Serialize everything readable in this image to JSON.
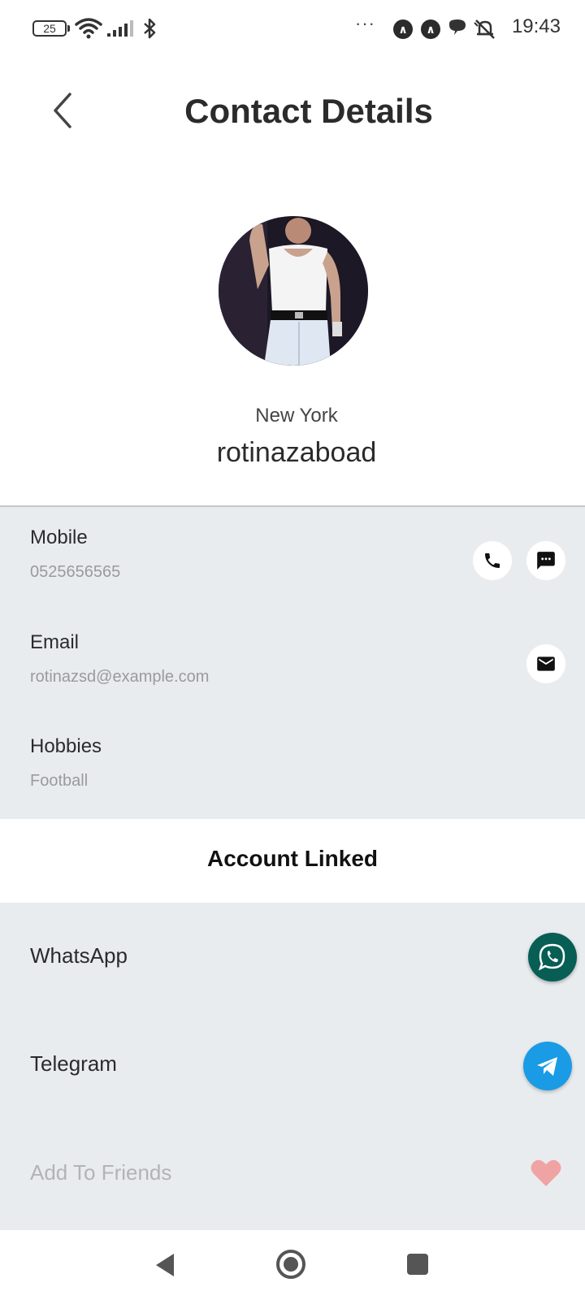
{
  "status_bar": {
    "battery_level": "25",
    "time": "19:43",
    "more": "···",
    "icons": [
      "battery-icon",
      "wifi-icon",
      "signal-icon",
      "bluetooth-icon",
      "more-icon",
      "app-notification-icon",
      "app-notification-icon",
      "chat-bubble-icon",
      "alarm-off-icon"
    ]
  },
  "header": {
    "title": "Contact Details",
    "back_icon": "chevron-left-icon"
  },
  "profile": {
    "city": "New York",
    "username": "rotinazaboad"
  },
  "fields": {
    "mobile": {
      "label": "Mobile",
      "value": "0525656565",
      "actions": [
        "phone-icon",
        "message-icon"
      ]
    },
    "email": {
      "label": "Email",
      "value": "rotinazsd@example.com",
      "actions": [
        "mail-icon"
      ]
    },
    "hobbies": {
      "label": "Hobbies",
      "value": "Football"
    }
  },
  "accounts": {
    "title": "Account Linked",
    "whatsapp": "WhatsApp",
    "telegram": "Telegram",
    "add_friends": "Add To Friends"
  },
  "colors": {
    "section_bg": "#e9ecef",
    "whatsapp": "#075e54",
    "telegram": "#1a9be6",
    "heart": "#f0a3a3"
  },
  "nav": {
    "icons": [
      "back-triangle-icon",
      "home-circle-icon",
      "recents-square-icon"
    ]
  }
}
